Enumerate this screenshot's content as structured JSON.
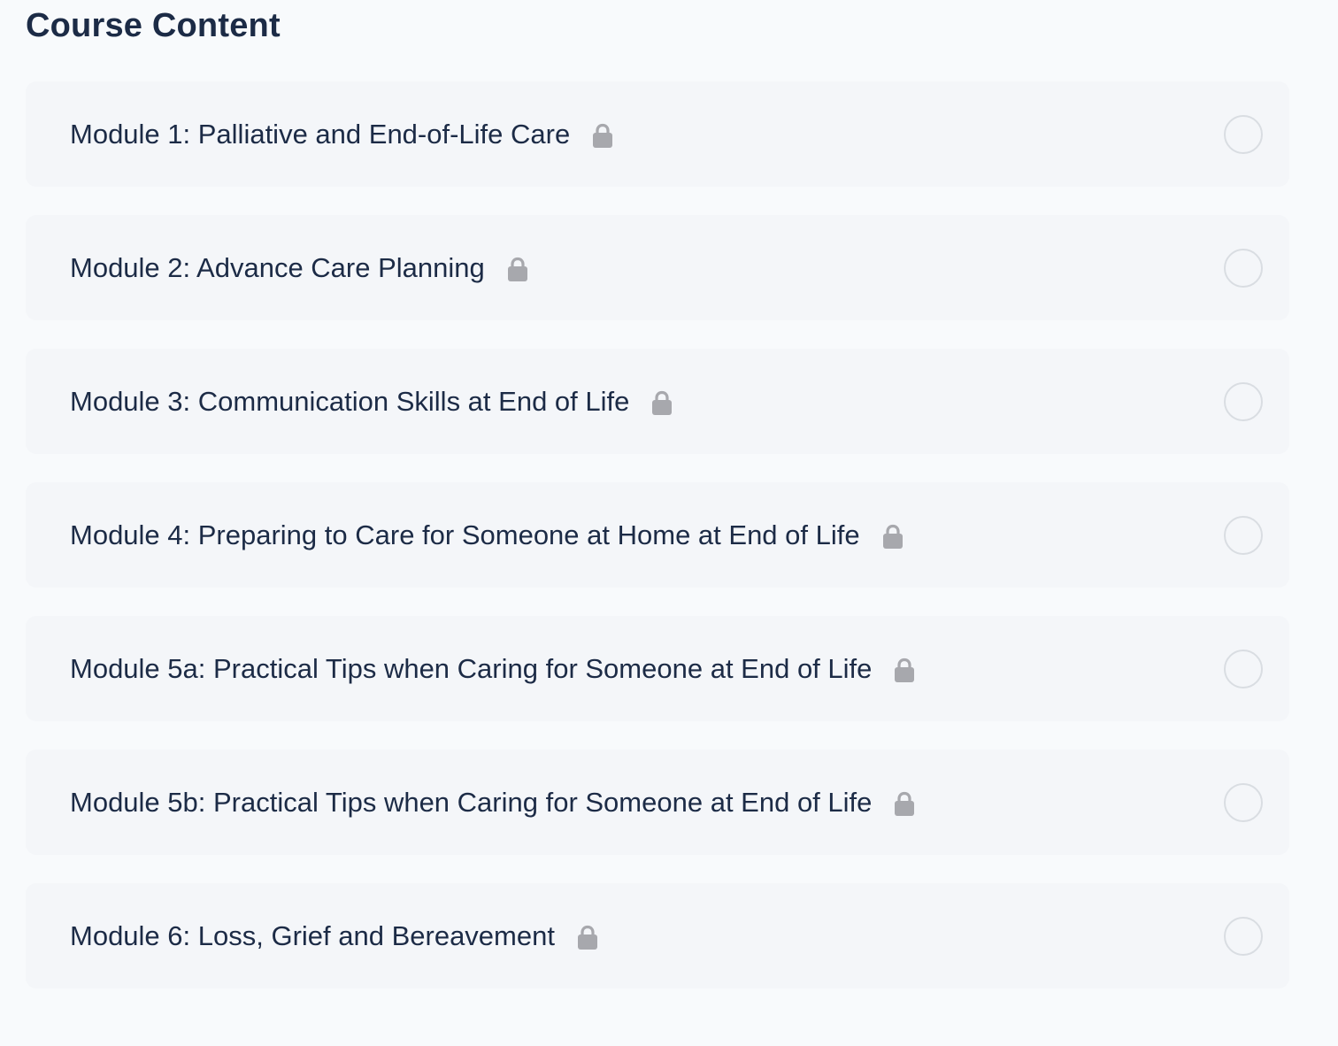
{
  "page": {
    "title": "Course Content"
  },
  "icons": {
    "lock": "lock-icon",
    "status": "circle-outline-icon"
  },
  "colors": {
    "text": "#1c2b46",
    "card_background": "#f4f6f9",
    "page_background": "#f8fafc",
    "lock_icon": "#a7a8ad",
    "status_circle": "#d9dde2"
  },
  "modules": [
    {
      "title": "Module 1: Palliative and End-of-Life Care"
    },
    {
      "title": "Module 2: Advance Care Planning"
    },
    {
      "title": "Module 3: Communication Skills at End of Life"
    },
    {
      "title": "Module 4: Preparing to Care for Someone at Home at End of Life"
    },
    {
      "title": "Module 5a: Practical Tips when Caring for Someone at End of Life"
    },
    {
      "title": "Module 5b: Practical Tips when Caring for Someone at End of Life"
    },
    {
      "title": "Module 6: Loss, Grief and Bereavement"
    }
  ]
}
